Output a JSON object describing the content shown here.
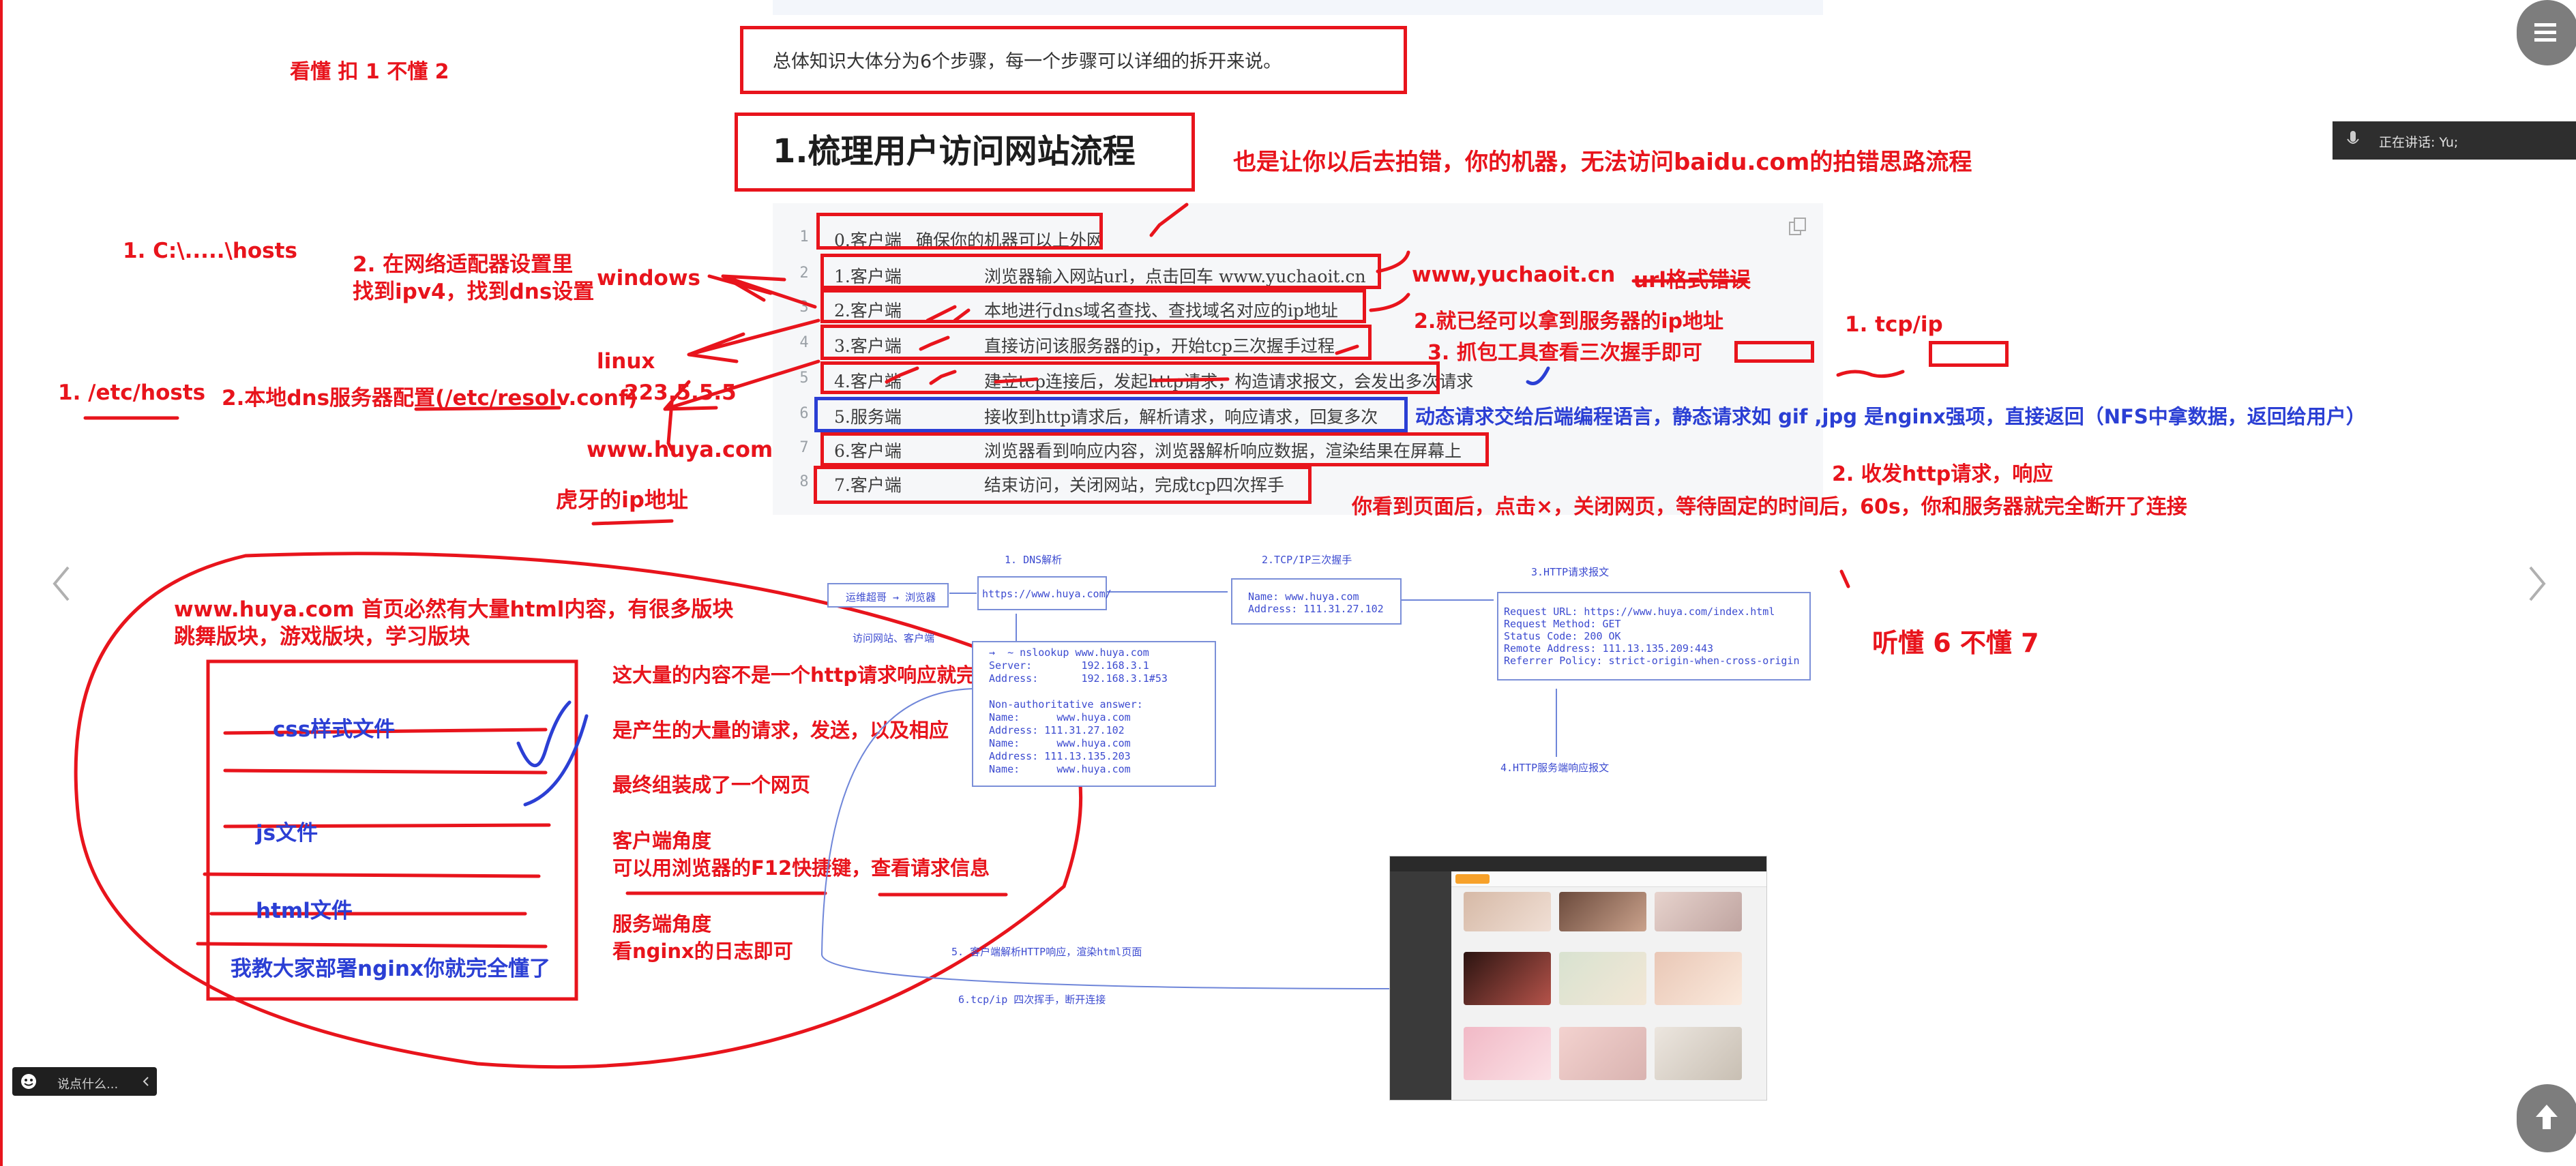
{
  "intro": "总体知识大体分为6个步骤，每一个步骤可以详细的拆开来说。",
  "heading": "1.梳理用户访问网站流程",
  "heading_note": "也是让你以后去拍错，你的机器，无法访问baidu.com的拍错思路流程",
  "top_left_note": "看懂 扣 1 不懂 2",
  "speaking_label": "正在讲话: Yu;",
  "code_lines": [
    {
      "no": "1",
      "role": "0.客户端",
      "desc": "确保你的机器可以上外网"
    },
    {
      "no": "2",
      "role": "1.客户端",
      "desc": "浏览器输入网站url，点击回车 www.yuchaoit.cn"
    },
    {
      "no": "3",
      "role": "2.客户端",
      "desc": "本地进行dns域名查找、查找域名对应的ip地址"
    },
    {
      "no": "4",
      "role": "3.客户端",
      "desc": "直接访问该服务器的ip，开始tcp三次握手过程"
    },
    {
      "no": "5",
      "role": "4.客户端",
      "desc": "建立tcp连接后，发起http请求，构造请求报文，会发出多次请求"
    },
    {
      "no": "6",
      "role": "5.服务端",
      "desc": "接收到http请求后，解析请求，响应请求，回复多次"
    },
    {
      "no": "7",
      "role": "6.客户端",
      "desc": "浏览器看到响应内容，浏览器解析响应数据，渲染结果在屏幕上"
    },
    {
      "no": "8",
      "role": "7.客户端",
      "desc": "结束访问，关闭网站，完成tcp四次挥手"
    }
  ],
  "annotations": {
    "win_hosts": "1. C:\\.....\\hosts",
    "win_adapter_1": "2. 在网络适配器设置里",
    "win_adapter_2": "找到ipv4，找到dns设置",
    "windows": "windows",
    "linux": "linux",
    "linux_hosts": "1. /etc/hosts",
    "linux_resolv": "2.本地dns服务器配置(/etc/resolv.conf)",
    "dns_ip": "223.5.5.5",
    "huya_domain": "www.huya.com",
    "huya_ip": "虎牙的ip地址",
    "url_ex": "www,yuchaoit.cn",
    "url_err": "url格式错误",
    "got_ip": "2.就已经可以拿到服务器的ip地址",
    "capture": "3. 抓包工具查看三次握手即可",
    "tcpip": "1. tcp/ip",
    "dynamic": "动态请求交给后端编程语言，静态请求如 gif ,jpg 是nginx强项，直接返回（NFS中拿数据，返回给用户）",
    "http_req": "2. 收发http请求，响应",
    "close_conn": "你看到页面后，点击×，关闭网页，等待固定的时间后，60s，你和服务器就完全断开了连接",
    "huya_home_1": "www.huya.com  首页必然有大量html内容，有很多版块",
    "huya_home_2": "跳舞版块，游戏版块，学习版块",
    "css": "css样式文件",
    "js": "js文件",
    "html": "html文件",
    "nginx_teach": "我教大家部署nginx你就完全懂了",
    "not_one": "这大量的内容不是一个http请求响应就完事的",
    "many_req": "是产生的大量的请求，发送，以及相应",
    "assembled": "最终组装成了一个网页",
    "client_view": "客户端角度",
    "f12": "可以用浏览器的F12快捷键，查看请求信息",
    "server_view": "服务端角度",
    "nginx_log": "看nginx的日志即可",
    "tally": "听懂  6  不懂 7"
  },
  "diagram": {
    "user_input": "运维超哥 → 浏览器",
    "visit": "访问网站、客户端",
    "dns_title": "1. DNS解析",
    "url_box": "https://www.huya.com/",
    "tcp_title": "2.TCP/IP三次握手",
    "tcp_name": "Name:      www.huya.com",
    "tcp_addr": "Address: 111.31.27.102",
    "http_title": "3.HTTP请求报文",
    "http_lines": [
      "Request URL: https://www.huya.com/index.html",
      "Request Method: GET",
      "Status Code: 200 OK",
      "Remote Address: 111.13.135.209:443",
      "Referrer Policy: strict-origin-when-cross-origin"
    ],
    "ns_lines": [
      "→  ~ nslookup www.huya.com",
      "Server:        192.168.3.1",
      "Address:       192.168.3.1#53",
      "",
      "Non-authoritative answer:",
      "Name:      www.huya.com",
      "Address: 111.31.27.102",
      "Name:      www.huya.com",
      "Address: 111.13.135.203",
      "Name:      www.huya.com"
    ],
    "response_title": "4.HTTP服务端响应报文",
    "render": "5. 客户端解析HTTP响应，渲染html页面",
    "close": "6.tcp/ip 四次挥手，断开连接"
  },
  "chat_placeholder": "说点什么...",
  "colors": {
    "annotation_red": "#e8141c",
    "annotation_blue": "#2b3fd4",
    "code_bg": "#f6f7f9"
  }
}
